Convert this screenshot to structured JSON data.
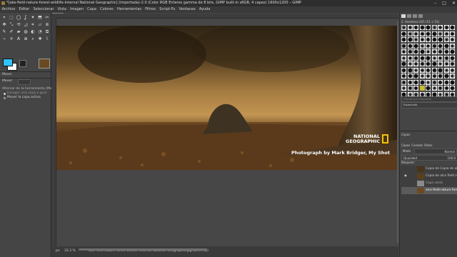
{
  "window": {
    "title": "*[ake-field-nature-forest-wildlife-Internal National Geographic] (importada)-2.0 (Color RGB Enteros gamma de 8 bits, GIMP built-in sRGB, 4 capas) 1600x1200 – GIMP",
    "controls": [
      "–",
      "□",
      "✕"
    ]
  },
  "menubar": [
    "Archivo",
    "Editar",
    "Seleccionar",
    "Vista",
    "Imagen",
    "Capa",
    "Colores",
    "Herramientas",
    "Filtros",
    "Script-Fu",
    "Ventanas",
    "Ayuda"
  ],
  "toolbox": {
    "tools": [
      "⌖",
      "⬚",
      "◯",
      "ʆ",
      "✦",
      "⬒",
      "✂",
      "✥",
      "⤡",
      "⟲",
      "◿",
      "⌗",
      "▱",
      "⧈",
      "✎",
      "✐",
      "▰",
      "◍",
      "◐",
      "◔",
      "⧉",
      "⌁",
      "⍟",
      "A",
      "⊕",
      "⌕",
      "✚",
      "⌇"
    ],
    "tool_names": [
      "move-icon",
      "rect-select-icon",
      "ellipse-select-icon",
      "free-select-icon",
      "fuzzy-select-icon",
      "by-color-select-icon",
      "scissors-icon",
      "foreground-select-icon",
      "crop-icon",
      "rotate-icon",
      "scale-icon",
      "shear-icon",
      "perspective-icon",
      "flip-icon",
      "pencil-icon",
      "paintbrush-icon",
      "eraser-icon",
      "airbrush-icon",
      "clone-icon",
      "heal-icon",
      "smudge-icon",
      "dodge-icon",
      "path-icon",
      "text-icon",
      "zoom-icon",
      "measure-icon",
      "color-picker-icon",
      "warp-icon"
    ],
    "fg_color": "#2ec4ff",
    "bg_color": "#ffffff",
    "options_title": "Mover",
    "options_mode_label": "Mover:",
    "options_tool_toggle": "Alternar de la herramienta (Mayús)",
    "options_radio_1": "Escoger una capa o guía",
    "options_radio_2": "Mover la capa activa"
  },
  "canvas": {
    "watermark_brand_line1": "NATIONAL",
    "watermark_brand_line2": "GEOGRAPHIC",
    "watermark_credit": "Photograph by Mark Bridger, My Shot",
    "brand_yellow": "#f5c400"
  },
  "statusbar": {
    "unit": "px",
    "zoom": "33.3 %",
    "file_info": "lake-field-nature-forest-wildlife-Internal-National-Geographic.jpg (21.6 MB)"
  },
  "dock": {
    "brush_panel_title": "2. Hardness 025 (51 × 51)",
    "brush_tag_placeholder": "Introduzca etiquetas",
    "spacing_label": "Espaciado",
    "layers_tabs": [
      "Capas",
      "Canales",
      "Rutas"
    ],
    "mode_label": "Modo",
    "mode_value": "Normal",
    "opacity_label": "Opacidad",
    "opacity_value": "100.0",
    "lock_label": "Bloquear:",
    "layers": [
      {
        "name": "Copia de Copia de alce fiel..."
      },
      {
        "name": "Copia de alce field nature..."
      },
      {
        "name": "Capa vacía"
      },
      {
        "name": "alce-field-nature-forest-w..."
      }
    ]
  }
}
